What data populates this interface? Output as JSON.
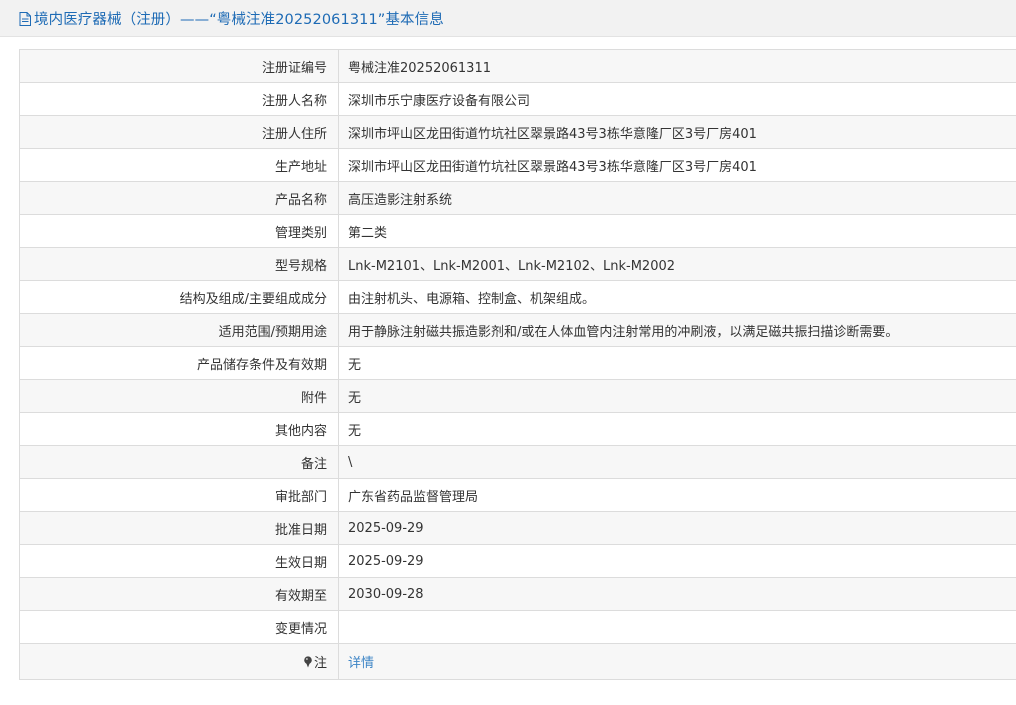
{
  "header": {
    "icon": "document-icon",
    "title": "境内医疗器械（注册）——“粤械注准20252061311”基本信息"
  },
  "rows": [
    {
      "label": "注册证编号",
      "value": "粤械注准20252061311"
    },
    {
      "label": "注册人名称",
      "value": "深圳市乐宁康医疗设备有限公司"
    },
    {
      "label": "注册人住所",
      "value": "深圳市坪山区龙田街道竹坑社区翠景路43号3栋华意隆厂区3号厂房401"
    },
    {
      "label": "生产地址",
      "value": "深圳市坪山区龙田街道竹坑社区翠景路43号3栋华意隆厂区3号厂房401"
    },
    {
      "label": "产品名称",
      "value": "高压造影注射系统"
    },
    {
      "label": "管理类别",
      "value": "第二类"
    },
    {
      "label": "型号规格",
      "value": "Lnk-M2101、Lnk-M2001、Lnk-M2102、Lnk-M2002"
    },
    {
      "label": "结构及组成/主要组成成分",
      "value": "由注射机头、电源箱、控制盒、机架组成。"
    },
    {
      "label": "适用范围/预期用途",
      "value": "用于静脉注射磁共振造影剂和/或在人体血管内注射常用的冲刷液，以满足磁共振扫描诊断需要。"
    },
    {
      "label": "产品储存条件及有效期",
      "value": "无"
    },
    {
      "label": "附件",
      "value": "无"
    },
    {
      "label": "其他内容",
      "value": "无"
    },
    {
      "label": "备注",
      "value": "\\"
    },
    {
      "label": "审批部门",
      "value": "广东省药品监督管理局"
    },
    {
      "label": "批准日期",
      "value": "2025-09-29"
    },
    {
      "label": "生效日期",
      "value": "2025-09-29"
    },
    {
      "label": "有效期至",
      "value": "2030-09-28"
    },
    {
      "label": "变更情况",
      "value": ""
    }
  ],
  "note_row": {
    "icon": "pin-icon",
    "label": "注",
    "link_text": "详情"
  },
  "colors": {
    "title": "#1e6bb5",
    "link": "#3d85c6",
    "header_bg": "#f2f2f2",
    "row_alt_bg": "#f7f7f7",
    "border": "#dcdcdc"
  }
}
